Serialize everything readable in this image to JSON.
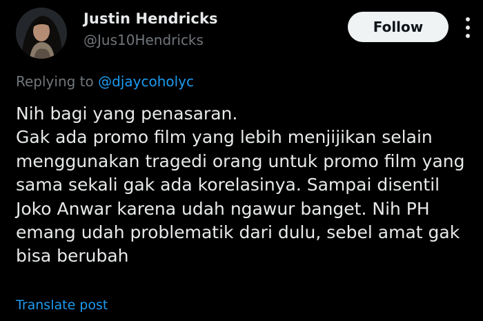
{
  "author": {
    "display_name": "Justin Hendricks",
    "handle": "@Jus10Hendricks"
  },
  "follow_label": "Follow",
  "reply": {
    "prefix": "Replying to",
    "mention": "@djaycoholyc"
  },
  "body_lines": [
    "Nih bagi yang penasaran.",
    "Gak ada promo film yang lebih menjijikan selain",
    "menggunakan tragedi orang untuk promo film yang",
    "sama sekali gak ada korelasinya. Sampai disentil",
    "Joko Anwar karena udah ngawur banget. Nih PH",
    "emang udah problematik dari dulu, sebel amat gak",
    "bisa berubah"
  ],
  "translate_label": "Translate post",
  "colors": {
    "background": "#000000",
    "primary_text": "#e7e9ea",
    "secondary_text": "#71767b",
    "link": "#1d9bf0",
    "follow_button_bg": "#eff3f4"
  },
  "icons": {
    "more": "more-vertical-icon"
  }
}
